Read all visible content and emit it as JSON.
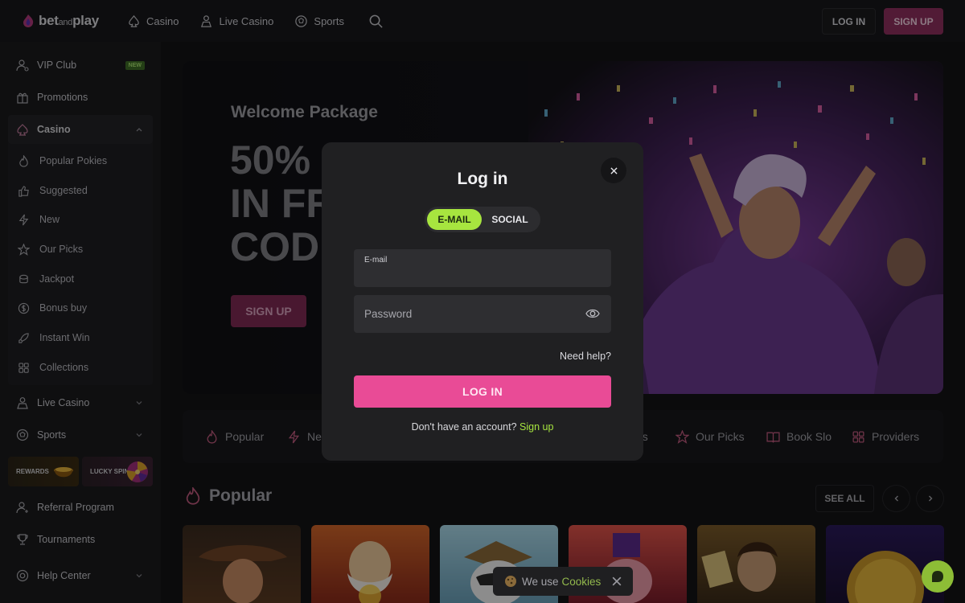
{
  "header": {
    "brand_main": "bet",
    "brand_small": "and",
    "brand_end": "play",
    "nav": [
      "Casino",
      "Live Casino",
      "Sports"
    ],
    "login": "LOG IN",
    "signup": "SIGN UP"
  },
  "sidebar": {
    "vip": "VIP Club",
    "vip_badge": "NEW",
    "promotions": "Promotions",
    "casino": "Casino",
    "casino_items": [
      "Popular Pokies",
      "Suggested",
      "New",
      "Our Picks",
      "Jackpot",
      "Bonus buy",
      "Instant Win",
      "Collections"
    ],
    "live_casino": "Live Casino",
    "sports": "Sports",
    "rewards": "REWARDS",
    "lucky_spin": "LUCKY SPIN",
    "referral": "Referral Program",
    "tournaments": "Tournaments",
    "help": "Help Center"
  },
  "hero": {
    "package": "Welcome Package",
    "line1": "50%",
    "line2": "IN FR",
    "line3": "CODI",
    "button": "SIGN UP"
  },
  "categories": [
    "Popular",
    "Ne",
    "es",
    "Our Picks",
    "Book Slo",
    "Providers"
  ],
  "popular": {
    "title": "Popular",
    "see_all": "SEE ALL"
  },
  "modal": {
    "title": "Log in",
    "tab_email": "E-MAIL",
    "tab_social": "SOCIAL",
    "email_label": "E-mail",
    "password_placeholder": "Password",
    "need_help": "Need help?",
    "login_button": "LOG IN",
    "no_account": "Don't have an account?",
    "signup_link": "Sign up"
  },
  "cookie": {
    "text": "We use",
    "link": "Cookies"
  },
  "colors": {
    "accent_green": "#a7e53f",
    "accent_pink": "#e94b96"
  }
}
